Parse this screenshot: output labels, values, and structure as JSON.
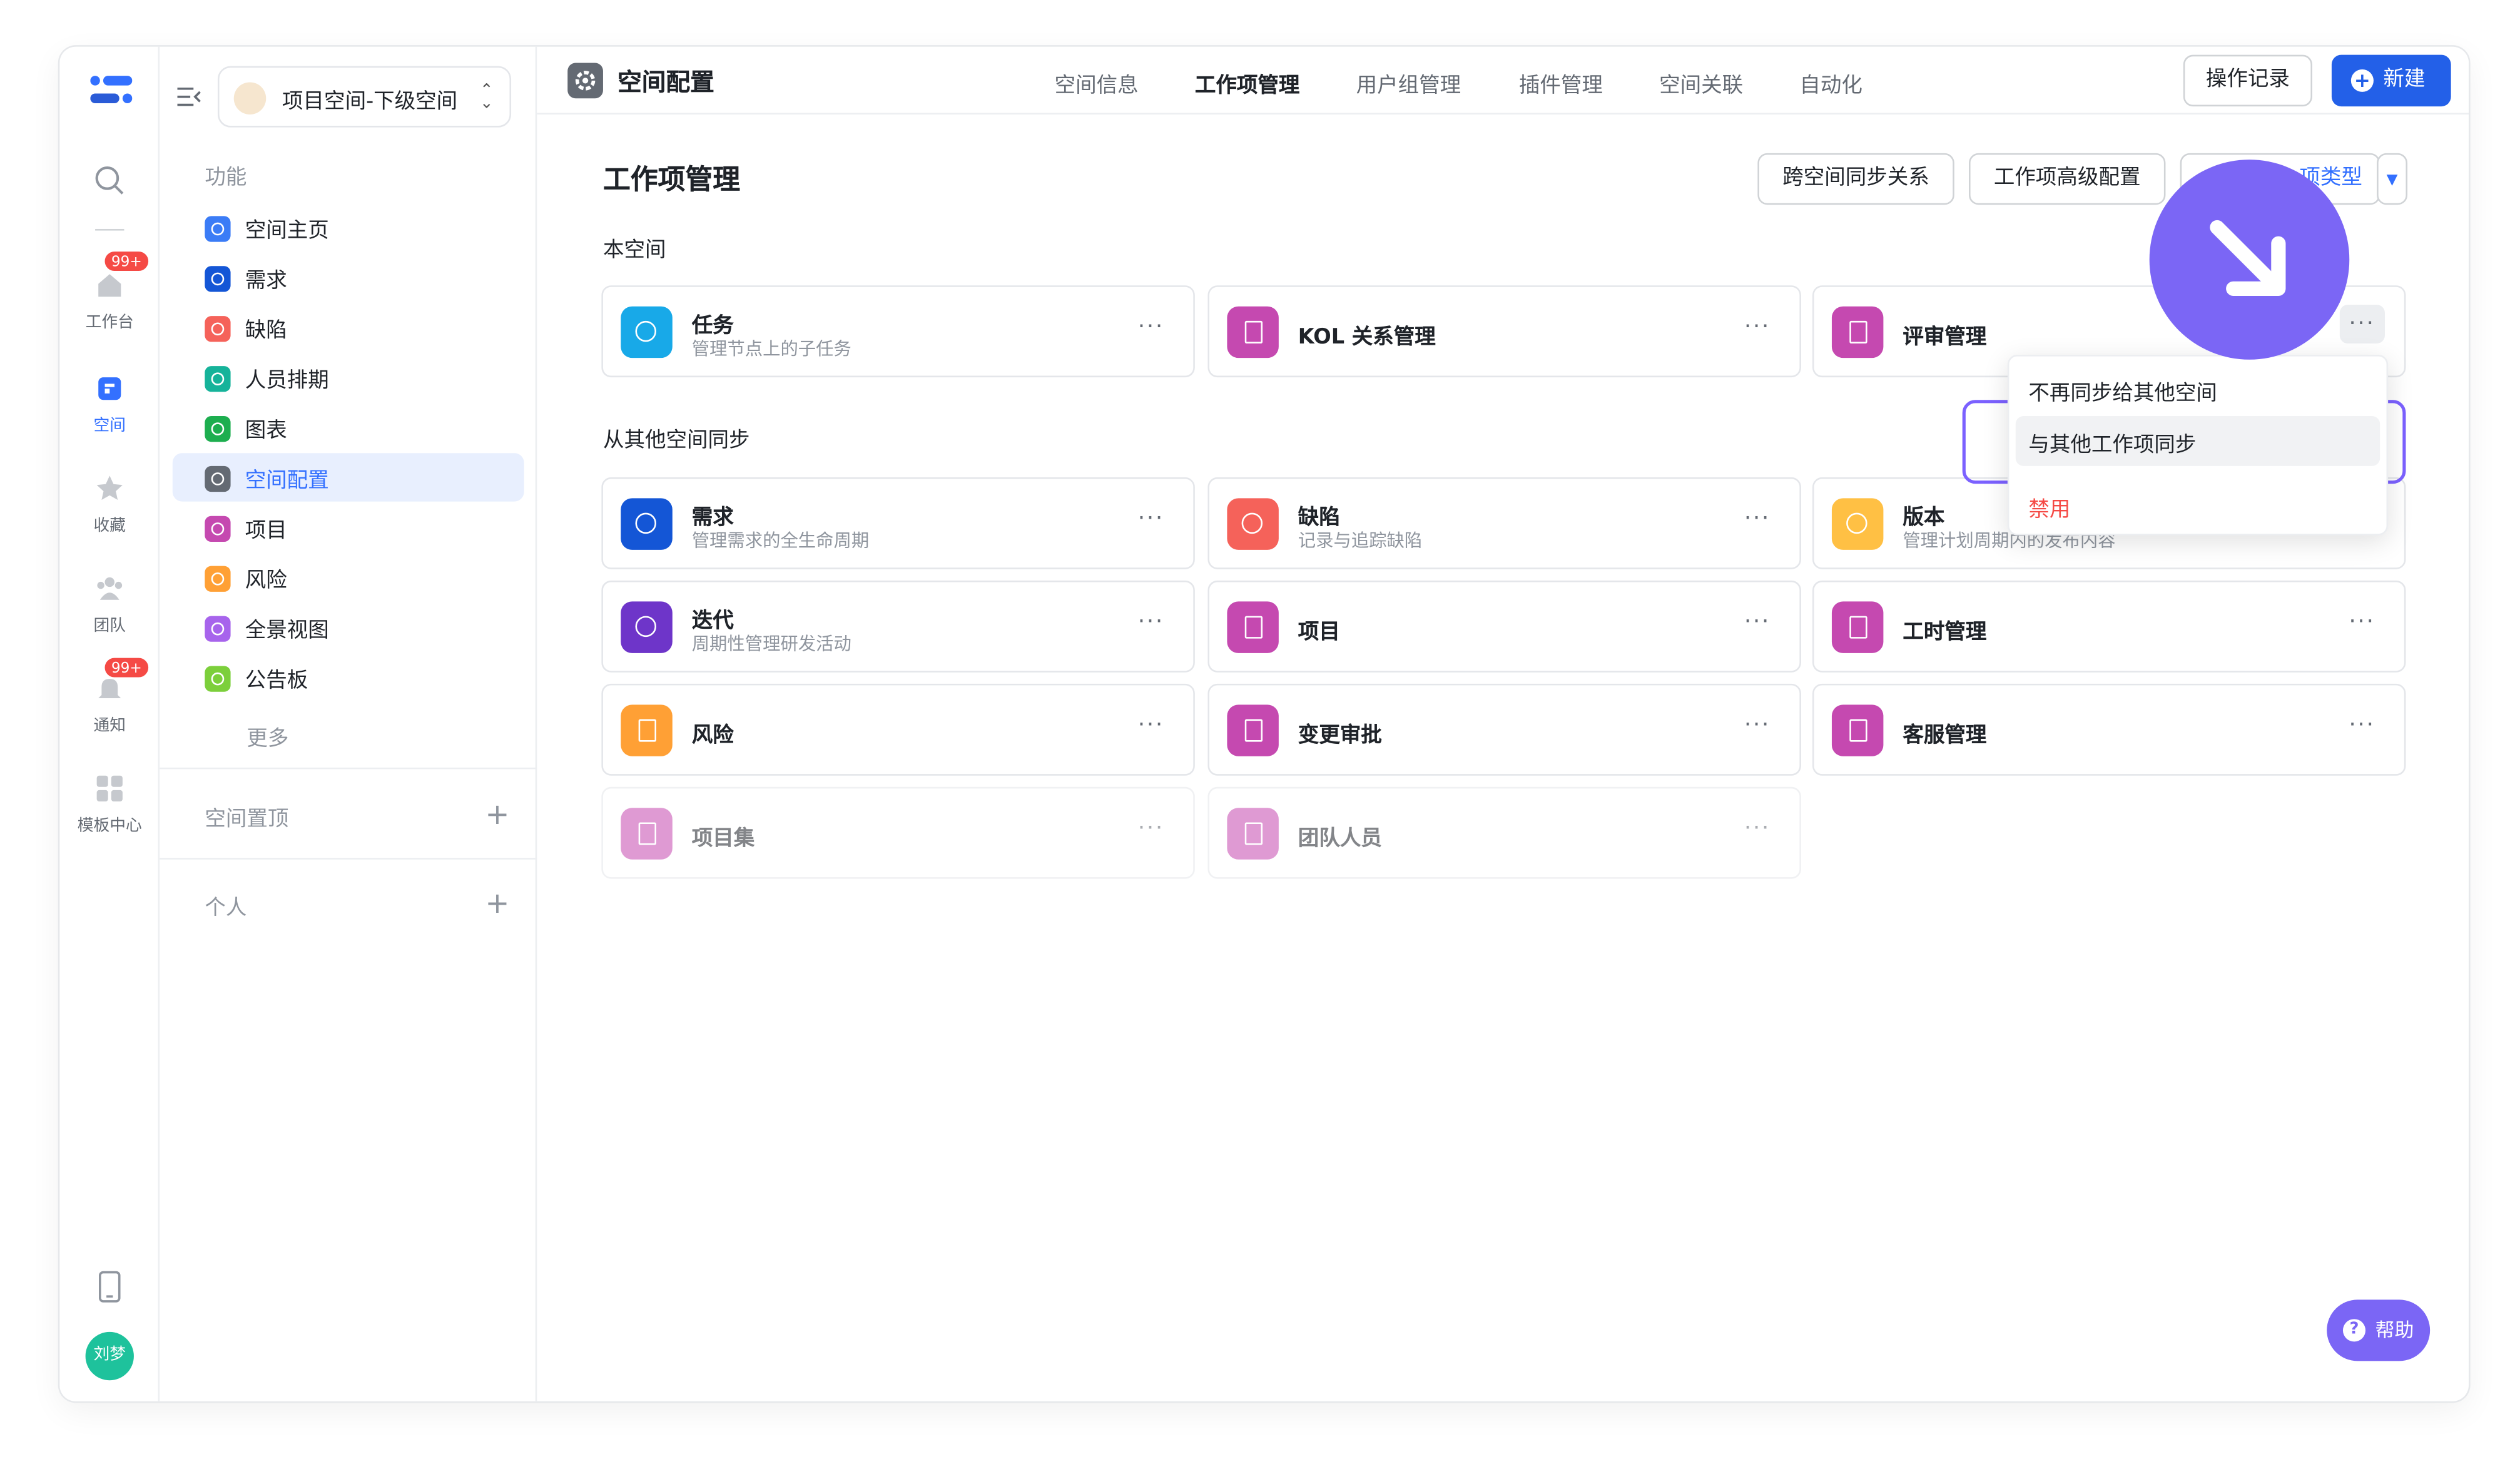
{
  "topbar": {
    "title": "空间配置",
    "tabs": [
      "空间信息",
      "工作项管理",
      "用户组管理",
      "插件管理",
      "空间关联",
      "自动化"
    ],
    "active_tab": "工作项管理",
    "ops_label": "操作记录",
    "new_label": "新建"
  },
  "rail": {
    "items": [
      {
        "label": "工作台",
        "badge": "99+"
      },
      {
        "label": "空间",
        "badge": ""
      },
      {
        "label": "收藏",
        "badge": ""
      },
      {
        "label": "团队",
        "badge": ""
      },
      {
        "label": "通知",
        "badge": "99+"
      },
      {
        "label": "模板中心",
        "badge": ""
      }
    ],
    "avatar": "刘梦"
  },
  "sidebar": {
    "space_name": "项目空间-下级空间",
    "section_label": "功能",
    "items": [
      {
        "label": "空间主页",
        "color": "#3b7cf6"
      },
      {
        "label": "需求",
        "color": "#1456d6"
      },
      {
        "label": "缺陷",
        "color": "#f5625a"
      },
      {
        "label": "人员排期",
        "color": "#16b39a"
      },
      {
        "label": "图表",
        "color": "#1dae4f"
      },
      {
        "label": "空间配置",
        "color": "#646a73"
      },
      {
        "label": "项目",
        "color": "#c549b0"
      },
      {
        "label": "风险",
        "color": "#ffa035"
      },
      {
        "label": "全景视图",
        "color": "#a764ec"
      },
      {
        "label": "公告板",
        "color": "#7ccf3b"
      }
    ],
    "more_label": "更多",
    "pinned_label": "空间置顶",
    "personal_label": "个人"
  },
  "main": {
    "title": "工作项管理",
    "cross_sync_btn": "跨空间同步关系",
    "advanced_btn": "工作项高级配置",
    "type_btn": "项类型",
    "local_section": "本空间",
    "synced_section": "从其他空间同步",
    "local_cards": [
      {
        "name": "任务",
        "desc": "管理节点上的子任务",
        "color": "#18a9e8"
      },
      {
        "name": "KOL 关系管理",
        "desc": "",
        "color": "#c549b0"
      },
      {
        "name": "评审管理",
        "desc": "",
        "color": "#c549b0"
      }
    ],
    "synced_cards": [
      {
        "name": "需求",
        "desc": "管理需求的全生命周期",
        "color": "#1456d6"
      },
      {
        "name": "缺陷",
        "desc": "记录与追踪缺陷",
        "color": "#f5625a"
      },
      {
        "name": "版本",
        "desc": "管理计划周期内的发布内容",
        "color": "#ffc044"
      },
      {
        "name": "迭代",
        "desc": "周期性管理研发活动",
        "color": "#6e35c9"
      },
      {
        "name": "项目",
        "desc": "",
        "color": "#c549b0"
      },
      {
        "name": "工时管理",
        "desc": "",
        "color": "#c549b0"
      },
      {
        "name": "风险",
        "desc": "",
        "color": "#ffa035"
      },
      {
        "name": "变更审批",
        "desc": "",
        "color": "#c549b0"
      },
      {
        "name": "客服管理",
        "desc": "",
        "color": "#c549b0"
      },
      {
        "name": "项目集",
        "desc": "",
        "color": "#c549b0"
      },
      {
        "name": "团队人员",
        "desc": "",
        "color": "#c549b0"
      }
    ],
    "more_glyph": "···"
  },
  "menu": {
    "items": [
      "不再同步给其他空间",
      "与其他工作项同步",
      "禁用"
    ]
  },
  "help_label": "帮助"
}
